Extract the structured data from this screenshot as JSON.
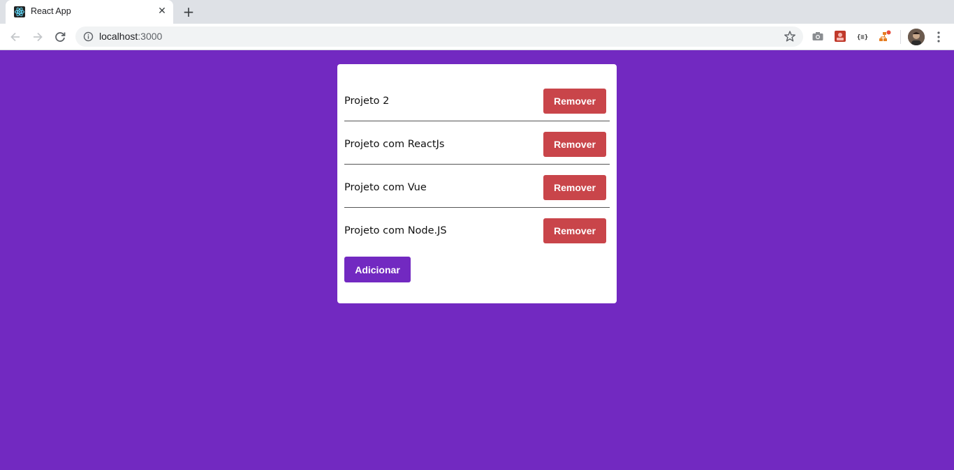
{
  "browser": {
    "tab_title": "React App",
    "tab_close": "✕",
    "new_tab": "+",
    "url_host": "localhost",
    "url_port": ":3000"
  },
  "theme": {
    "background": "#7229c1",
    "remove_button_color": "#c9454a",
    "add_button_color": "#7229c1"
  },
  "projects": [
    {
      "name": "Projeto 2",
      "remove_label": "Remover"
    },
    {
      "name": "Projeto com ReactJs",
      "remove_label": "Remover"
    },
    {
      "name": "Projeto com Vue",
      "remove_label": "Remover"
    },
    {
      "name": "Projeto com Node.JS",
      "remove_label": "Remover"
    }
  ],
  "add_label": "Adicionar"
}
